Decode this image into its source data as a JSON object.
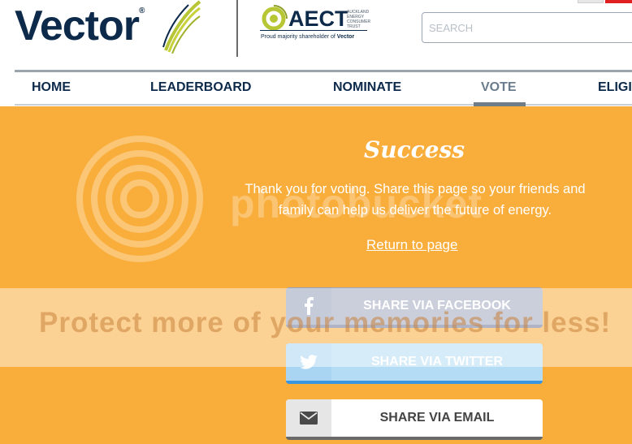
{
  "header": {
    "logo_text": "Vector",
    "logo_reg": "®",
    "aect_name": "AECT",
    "aect_subtitle": "AUCKLAND ENERGY CONSUMER TRUST",
    "aect_tagline_prefix": "Proud majority shareholder of ",
    "aect_tagline_brand": "Vector",
    "search_placeholder": "SEARCH"
  },
  "nav": {
    "items": [
      {
        "label": "HOME"
      },
      {
        "label": "LEADERBOARD"
      },
      {
        "label": "NOMINATE"
      },
      {
        "label": "VOTE",
        "active": true
      },
      {
        "label": "ELIGI"
      }
    ]
  },
  "main": {
    "title": "Success",
    "message": "Thank you for voting. Share this page so your friends and family can help us deliver the future of energy.",
    "return_link": "Return to page",
    "watermark_brand": "photobucket",
    "watermark_banner": "Protect more of your memories for less!",
    "share_buttons": [
      {
        "label": "SHARE VIA FACEBOOK",
        "icon": "facebook-icon"
      },
      {
        "label": "SHARE VIA TWITTER",
        "icon": "twitter-icon"
      },
      {
        "label": "SHARE VIA EMAIL",
        "icon": "email-icon"
      }
    ]
  },
  "colors": {
    "brand_navy": "#0d2a4a",
    "background_orange": "#f9ae3c",
    "logo_green": "#b7c634",
    "twitter_blue": "#3a95e0"
  }
}
